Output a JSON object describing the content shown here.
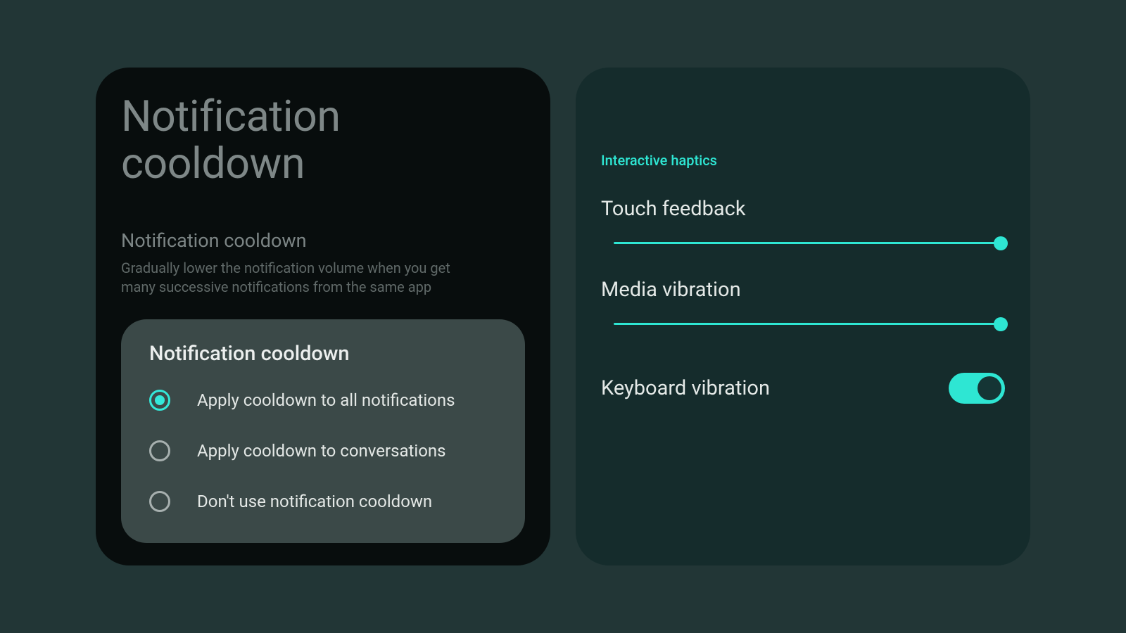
{
  "left": {
    "title": "Notification cooldown",
    "subtitle": "Notification cooldown",
    "description": "Gradually lower the notification volume when you get many successive notifications from the same app",
    "options_title": "Notification cooldown",
    "options": [
      {
        "label": "Apply cooldown to all notifications",
        "selected": true
      },
      {
        "label": "Apply cooldown to conversations",
        "selected": false
      },
      {
        "label": "Don't use notification cooldown",
        "selected": false
      }
    ]
  },
  "right": {
    "section_header": "Interactive haptics",
    "touch_feedback": {
      "label": "Touch feedback",
      "value": 100
    },
    "media_vibration": {
      "label": "Media vibration",
      "value": 100
    },
    "keyboard_vibration": {
      "label": "Keyboard vibration",
      "enabled": true
    }
  }
}
